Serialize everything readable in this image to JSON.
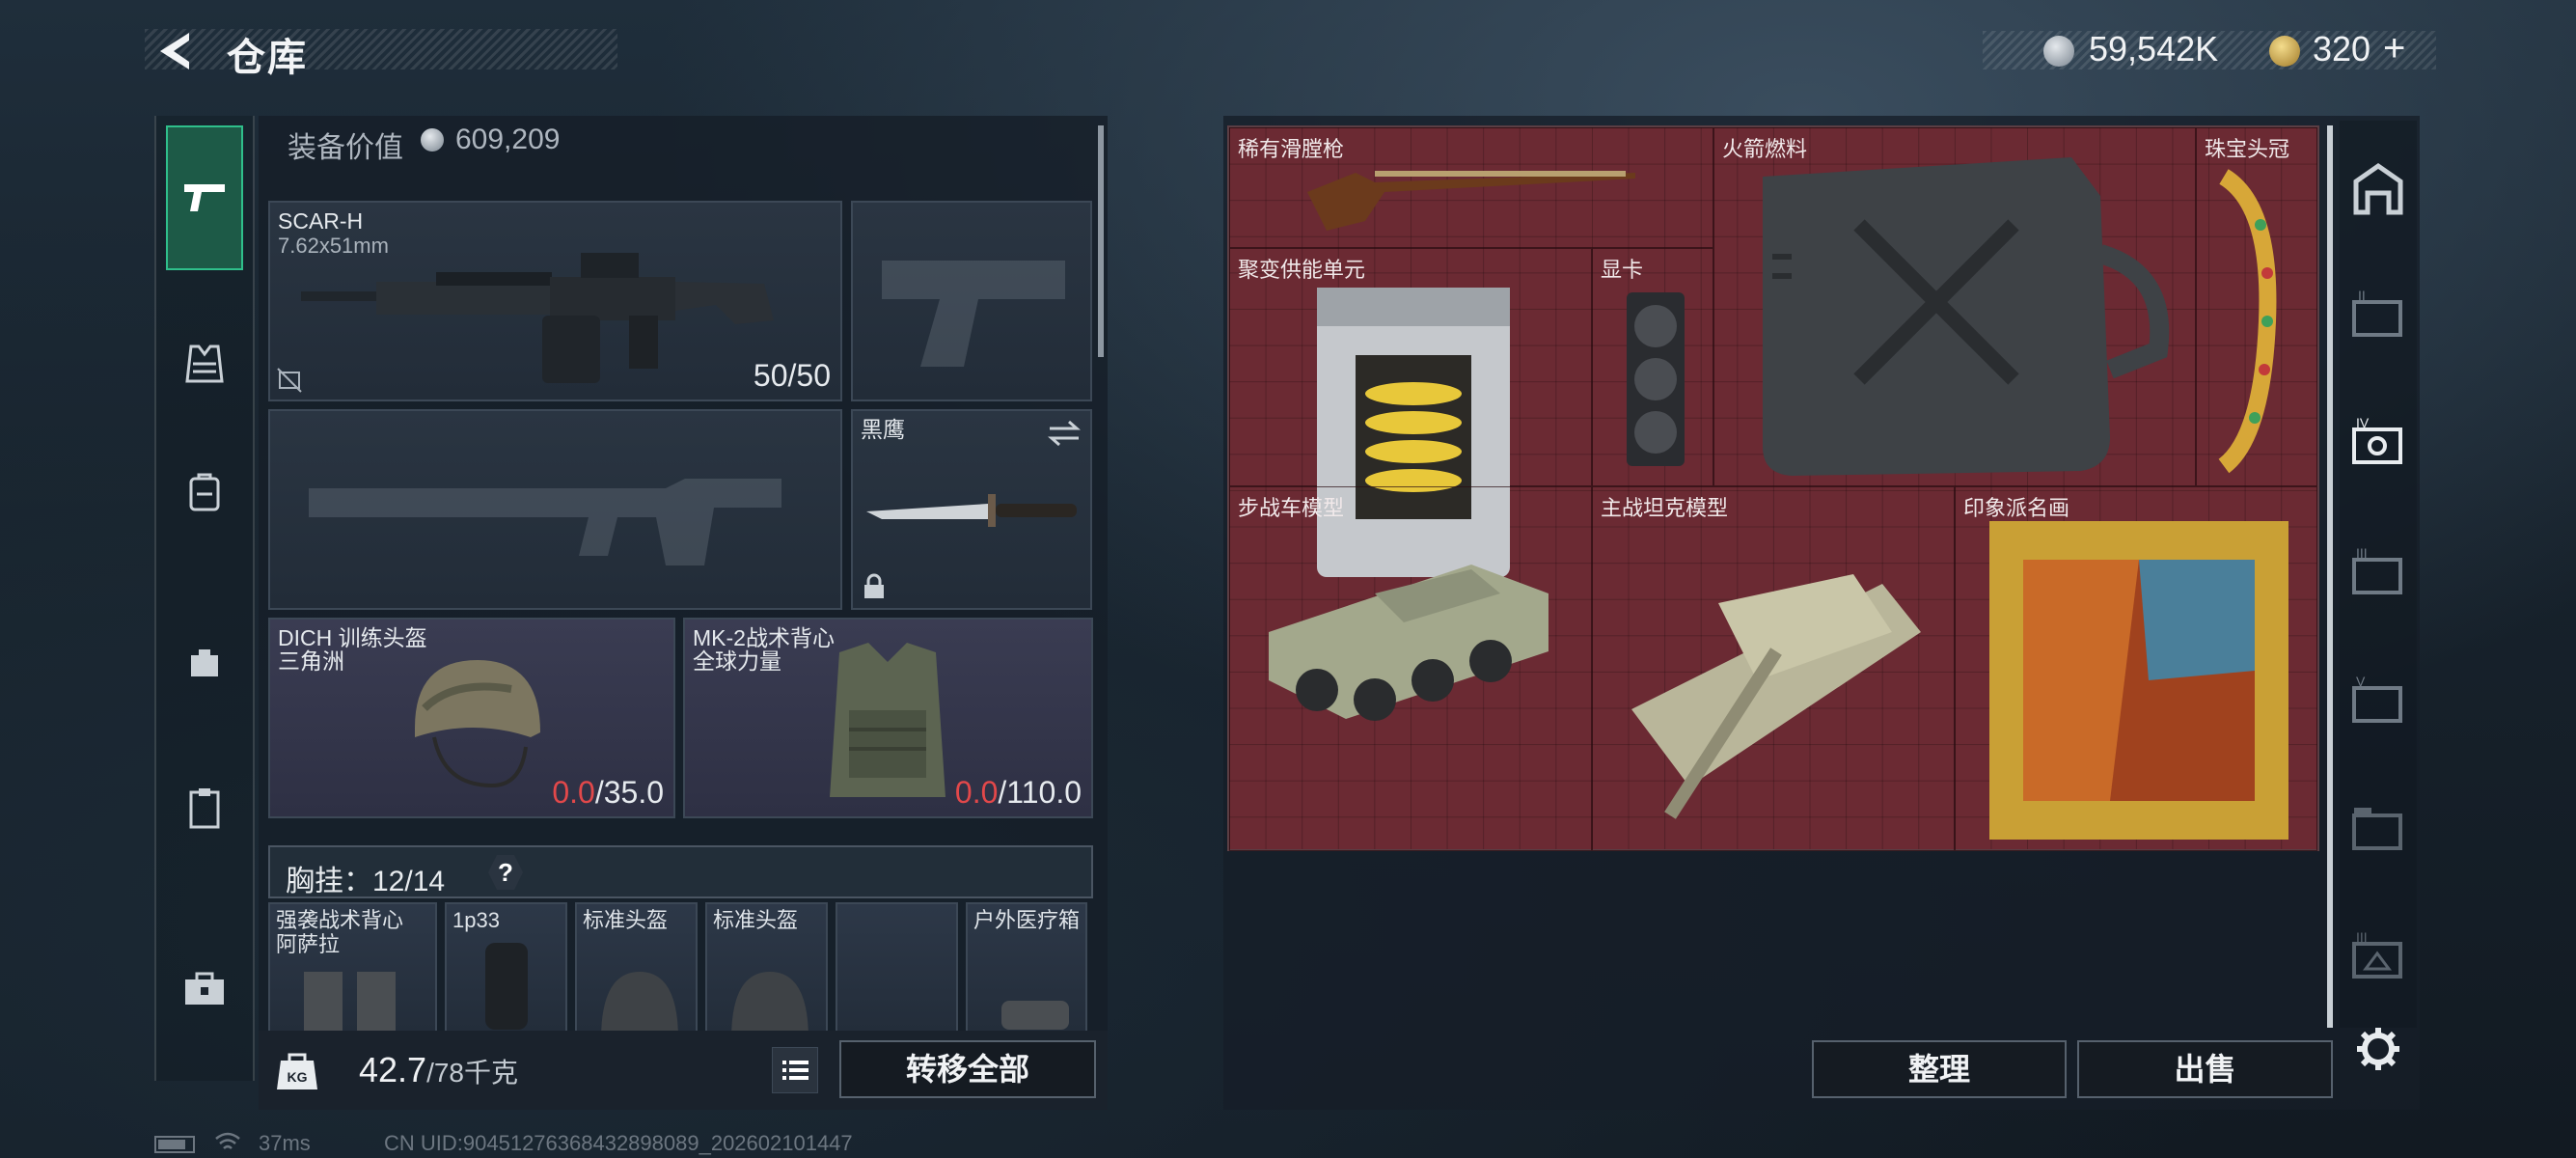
{
  "header": {
    "title": "仓库",
    "currency1": "59,542K",
    "currency2": "320",
    "currency2_plus": "+"
  },
  "loadout": {
    "worth_label": "装备价值",
    "worth_value": "609,209",
    "primary": {
      "name": "SCAR-H",
      "caliber": "7.62x51mm",
      "ammo": "50/50"
    },
    "melee": {
      "name": "黑鹰"
    },
    "helmet": {
      "name": "DICH 训练头盔",
      "faction": "三角洲",
      "dura_cur": "0.0",
      "dura_max": "/35.0"
    },
    "armor": {
      "name": "MK-2战术背心",
      "faction": "全球力量",
      "dura_cur": "0.0",
      "dura_max": "/110.0"
    },
    "chest_label": "胸挂：12/14",
    "chest_help": "?",
    "chest_items": [
      {
        "name": "强袭战术背心\n阿萨拉"
      },
      {
        "name": "1p33"
      },
      {
        "name": "标准头盔"
      },
      {
        "name": "标准头盔"
      },
      {
        "name": ""
      },
      {
        "name": "户外医疗箱"
      }
    ]
  },
  "bottom": {
    "weight": "42.7",
    "weight_max": "/78千克",
    "transfer_all": "转移全部",
    "sort": "整理",
    "sell": "出售"
  },
  "stash_items": [
    {
      "name": "稀有滑膛枪"
    },
    {
      "name": "火箭燃料"
    },
    {
      "name": "珠宝头冠"
    },
    {
      "name": "聚变供能单元"
    },
    {
      "name": "显卡"
    },
    {
      "name": "主战坦克模型"
    },
    {
      "name": "印象派名画"
    },
    {
      "name": "步战车模型"
    }
  ],
  "status": {
    "ping": "37ms",
    "uid": "CN UID:9045127636843289808​9_202602101447"
  },
  "colors": {
    "grid_bg": "#6b2a33",
    "accent_green": "#2fbf8b",
    "durability_red": "#e2484a"
  }
}
